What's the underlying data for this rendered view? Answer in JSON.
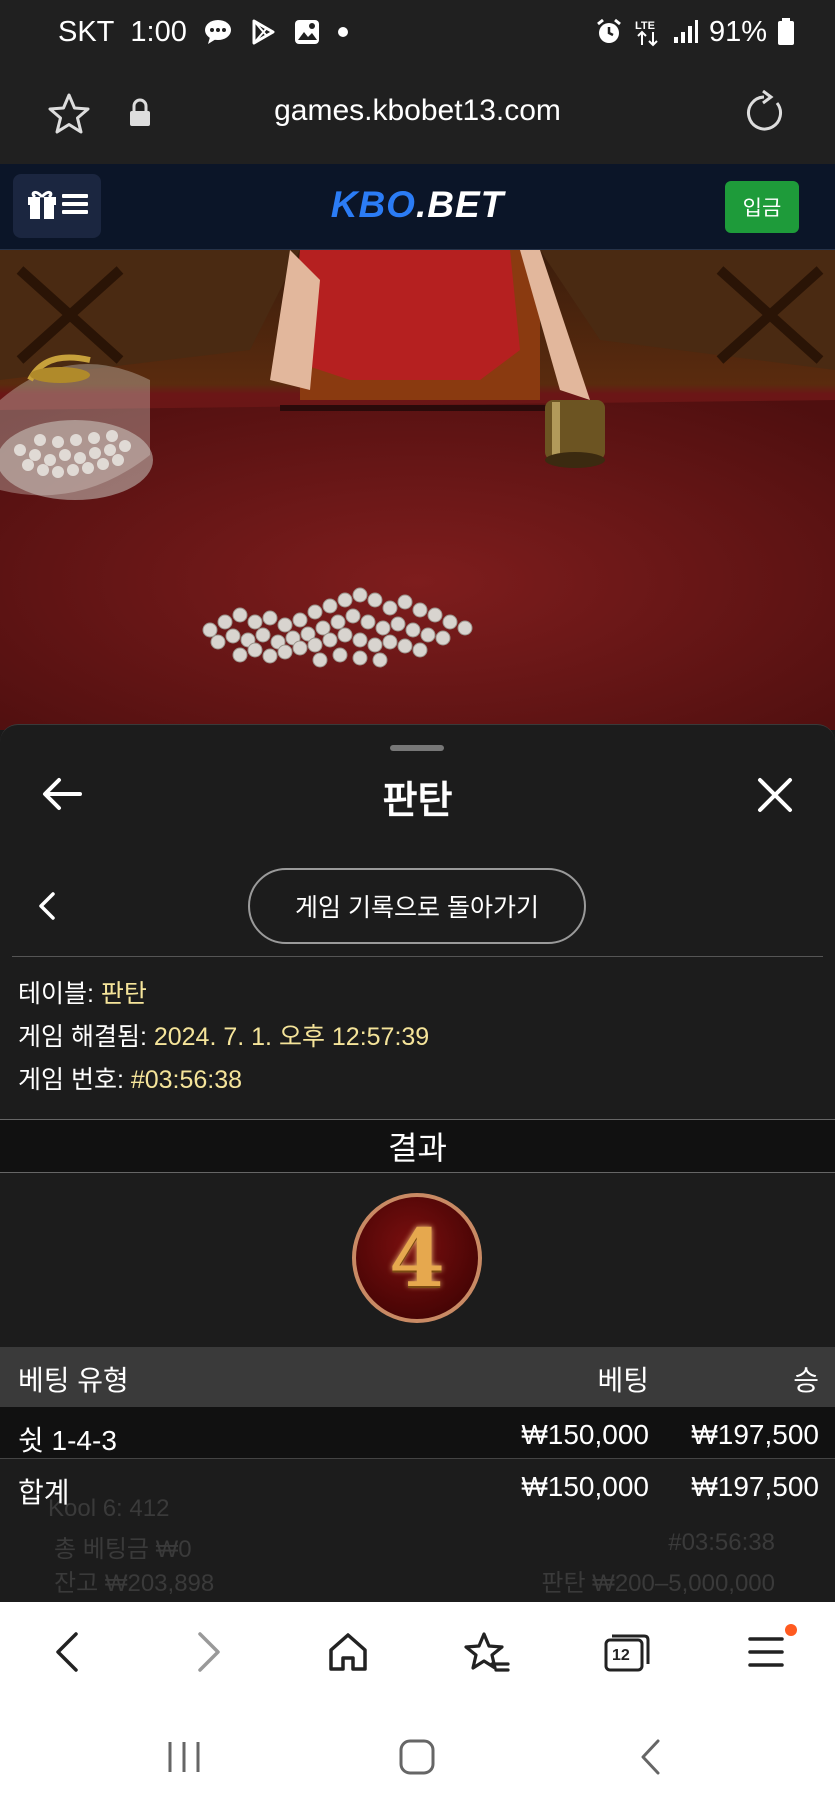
{
  "status_bar": {
    "carrier": "SKT",
    "time": "1:00",
    "battery": "91%",
    "icons": [
      "chat-icon",
      "play-store-icon",
      "gallery-icon",
      "dot-icon",
      "alarm-icon",
      "lte-icon",
      "signal-icon",
      "battery-icon"
    ]
  },
  "browser": {
    "url": "games.kbobet13.com",
    "bottom_bar": {
      "tabs_count": "12",
      "items": [
        "back-icon",
        "forward-icon",
        "home-icon",
        "bookmarks-icon",
        "tabs-icon",
        "menu-icon"
      ]
    }
  },
  "site": {
    "logo_kbo": "KBO",
    "logo_bet": ".BET",
    "deposit_label": "입금",
    "menu_icons": [
      "gift-icon",
      "hamburger-icon"
    ]
  },
  "sheet": {
    "title": "판탄",
    "back_to_history_label": "게임 기록으로 돌아가기",
    "info": [
      {
        "label": "테이블: ",
        "value": "판탄"
      },
      {
        "label": "게임 해결됨: ",
        "value": "2024. 7. 1. 오후 12:57:39"
      },
      {
        "label": "게임 번호: ",
        "value": "#03:56:38"
      }
    ],
    "result_label": "결과",
    "result_value": "4",
    "table": {
      "headers": {
        "type": "베팅 유형",
        "bet": "베팅",
        "win": "승"
      },
      "rows": [
        {
          "type": "쉿 1-4-3",
          "bet": "₩150,000",
          "win": "₩197,500"
        },
        {
          "type": "합계",
          "bet": "₩150,000",
          "win": "₩197,500"
        }
      ]
    },
    "background_ghost_text": {
      "line1": "Kool 6: 412",
      "line2": "총 베팅금 ₩0",
      "line3": "잔고 ₩203,898",
      "line4": "판탄 ₩200–5,000,000",
      "line5": "#03:56:38"
    }
  },
  "colors": {
    "accent_blue": "#2b7cf5",
    "deposit_green": "#1e9b3a",
    "value_gold": "#f5e49a",
    "table_red": "#6b1515"
  }
}
